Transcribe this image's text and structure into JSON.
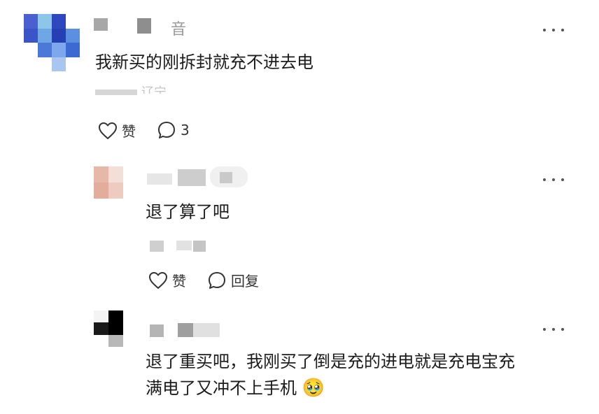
{
  "comment": {
    "text": "我新买的刚拆封就充不进去电",
    "username_fragment": "音",
    "meta_fragment": "辽宁",
    "like_label": "赞",
    "reply_count": "3"
  },
  "reply1": {
    "text": "退了算了吧",
    "like_label": "赞",
    "reply_label": "回复"
  },
  "reply2": {
    "line1": "退了重买吧，我刚买了倒是充的进电就是充电宝充",
    "line2": "满电了又冲不上手机",
    "emoji": "🥹"
  },
  "colors": {
    "avatar1": [
      "#3b57c4",
      "#7fb4e8",
      "#2a3fa8",
      "#5c86d8"
    ],
    "avatar2": [
      "#e9bfb0",
      "#f2d6cc",
      "#d99e8e"
    ],
    "avatar3": [
      "#000000",
      "#ffffff",
      "#9a9a9a"
    ]
  }
}
